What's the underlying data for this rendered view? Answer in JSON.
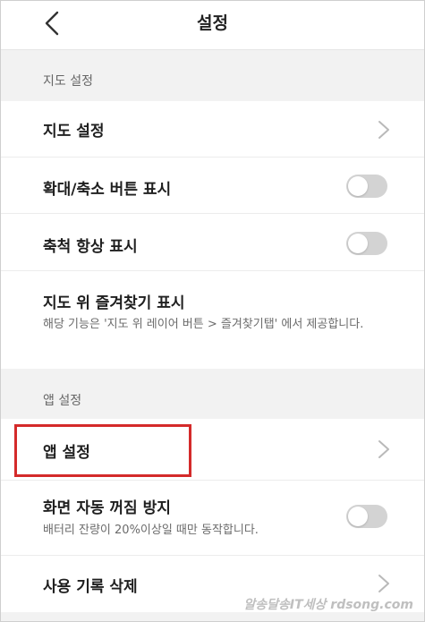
{
  "header": {
    "title": "설정",
    "back_icon": "chevron-left-icon"
  },
  "sections": [
    {
      "title": "지도 설정",
      "items": [
        {
          "label": "지도 설정",
          "control": "chevron"
        },
        {
          "label": "확대/축소 버튼 표시",
          "control": "toggle",
          "toggle_on": false
        },
        {
          "label": "축척 항상 표시",
          "control": "toggle",
          "toggle_on": false
        },
        {
          "label": "지도 위 즐겨찾기 표시",
          "description": "해당 기능은 '지도 위 레이어 버튼 > 즐겨찾기탭' 에서 제공합니다.",
          "control": "none"
        }
      ]
    },
    {
      "title": "앱 설정",
      "items": [
        {
          "label": "앱 설정",
          "control": "chevron",
          "highlighted": true
        },
        {
          "label": "화면 자동 꺼짐 방지",
          "description": "배터리 잔량이 20%이상일 때만 동작합니다.",
          "control": "toggle",
          "toggle_on": false
        },
        {
          "label": "사용 기록 삭제",
          "control": "chevron"
        }
      ]
    }
  ],
  "watermark": "알송달송IT세상 rdsong.com",
  "colors": {
    "highlight": "#d42a2a",
    "toggle_off_track": "#d3d3d3",
    "section_bg": "#f2f2f2"
  }
}
